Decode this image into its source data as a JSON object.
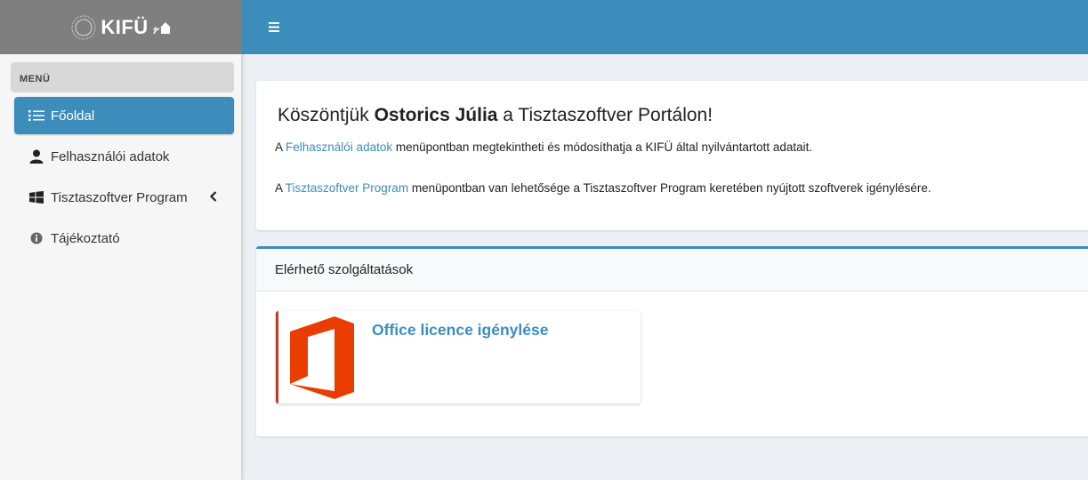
{
  "brand": {
    "logo_text": "KIFÜ"
  },
  "sidebar": {
    "menu_header": "MENÜ",
    "items": [
      {
        "label": "Főoldal",
        "icon": "list-icon",
        "active": true
      },
      {
        "label": "Felhasználói adatok",
        "icon": "user-icon",
        "active": false
      },
      {
        "label": "Tisztaszoftver Program",
        "icon": "windows-icon",
        "active": false
      },
      {
        "label": "Tájékoztató",
        "icon": "info-icon",
        "active": false
      }
    ]
  },
  "welcome": {
    "greeting_prefix": "Köszöntjük ",
    "user_name": "Ostorics Júlia",
    "greeting_suffix": " a Tisztaszoftver Portálon!",
    "line1_prefix": "A ",
    "line1_link": "Felhasználói adatok",
    "line1_suffix": " menüpontban megtekintheti és módosíthatja a KIFÜ által nyilvántartott adatait.",
    "line2_prefix": "A ",
    "line2_link": "Tisztaszoftver Program",
    "line2_suffix": " menüpontban van lehetősége a Tisztaszoftver Program keretében nyújtott szoftverek igénylésére."
  },
  "services": {
    "title": "Elérhető szolgáltatások",
    "cards": [
      {
        "title": "Office licence igénylése",
        "icon": "office-icon"
      }
    ]
  },
  "colors": {
    "accent": "#3c8dbc",
    "office_orange": "#eb3c00",
    "card_border": "#c0392b",
    "logo_bar": "#7f7f7f"
  }
}
